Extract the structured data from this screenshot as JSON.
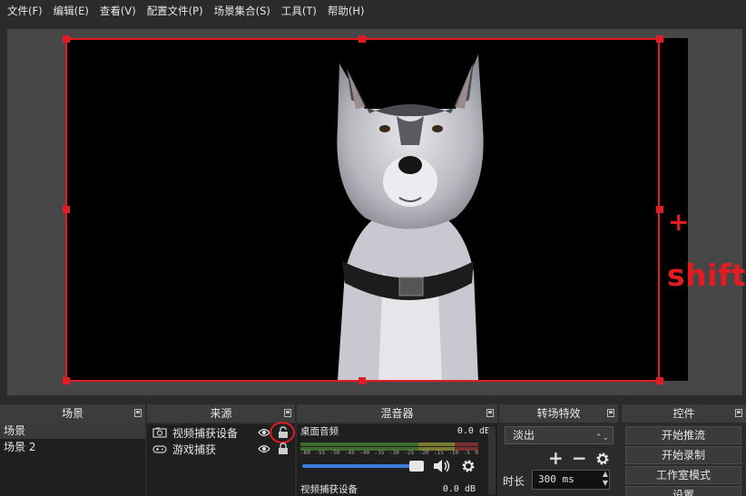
{
  "menu": [
    "文件(F)",
    "编辑(E)",
    "查看(V)",
    "配置文件(P)",
    "场景集合(S)",
    "工具(T)",
    "帮助(H)"
  ],
  "annotations": {
    "plus": "+",
    "shift": "shift"
  },
  "docks": {
    "scenes": {
      "title": "场景",
      "items": [
        "场景",
        "场景 2"
      ]
    },
    "sources": {
      "title": "来源",
      "items": [
        {
          "label": "视频捕获设备",
          "icon": "camera-icon"
        },
        {
          "label": "游戏捕获",
          "icon": "gamepad-icon"
        }
      ]
    },
    "mixer": {
      "title": "混音器",
      "channels": [
        {
          "name": "桌面音频",
          "db": "0.0 dB"
        },
        {
          "name": "视频捕获设备",
          "db": "0.0 dB"
        }
      ],
      "ticks": [
        "-60",
        "-55",
        "-50",
        "-45",
        "-40",
        "-35",
        "-30",
        "-25",
        "-20",
        "-15",
        "-10",
        "-5",
        "0"
      ]
    },
    "transitions": {
      "title": "转场特效",
      "selected": "淡出",
      "duration_label": "时长",
      "duration_value": "300 ms"
    },
    "controls": {
      "title": "控件",
      "buttons": [
        "开始推流",
        "开始录制",
        "工作室模式",
        "设置"
      ]
    }
  },
  "colors": {
    "annotation": "#e31b23",
    "background": "#2b2b2b",
    "preview": "#474747"
  }
}
